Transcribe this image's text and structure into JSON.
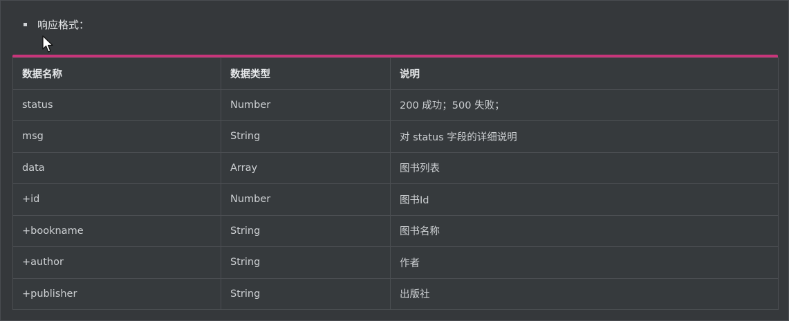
{
  "section": {
    "heading": "响应格式："
  },
  "table": {
    "headers": [
      "数据名称",
      "数据类型",
      "说明"
    ],
    "rows": [
      [
        "status",
        "Number",
        "200 成功；500 失败；"
      ],
      [
        "msg",
        "String",
        "对 status 字段的详细说明"
      ],
      [
        "data",
        "Array",
        "图书列表"
      ],
      [
        "+id",
        "Number",
        "图书Id"
      ],
      [
        "+bookname",
        "String",
        "图书名称"
      ],
      [
        "+author",
        "String",
        "作者"
      ],
      [
        "+publisher",
        "String",
        "出版社"
      ]
    ]
  },
  "colors": {
    "accent": "#c8357a",
    "background": "#35383b"
  },
  "icons": {
    "bullet": "square-bullet-icon",
    "cursor": "mouse-pointer-icon"
  }
}
